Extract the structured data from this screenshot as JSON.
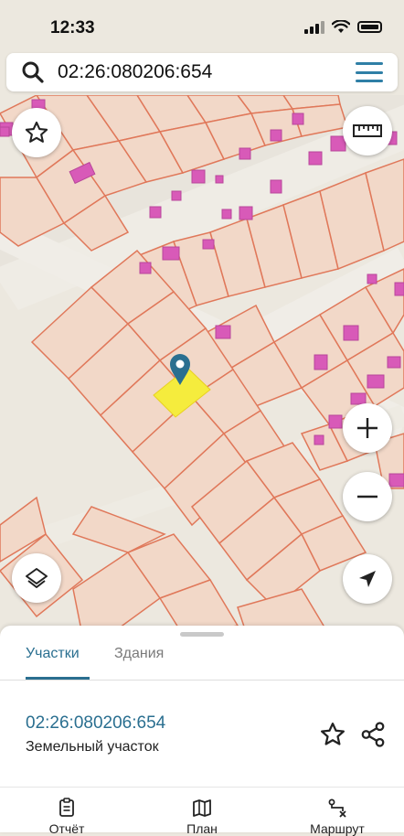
{
  "status": {
    "time": "12:33"
  },
  "search": {
    "query": "02:26:080206:654"
  },
  "map_buttons": {
    "favorite_icon": "star-outline",
    "ruler_icon": "ruler",
    "zoom_in_icon": "plus",
    "zoom_out_icon": "minus",
    "layers_icon": "layers",
    "location_icon": "navigation-arrow"
  },
  "colors": {
    "parcel_fill": "#f2d8c8",
    "parcel_stroke": "#e0785a",
    "building": "#d85ab8",
    "selected_parcel": "#f5ec3d",
    "pin": "#2a6f90",
    "accent": "#2a6f90"
  },
  "sheet": {
    "tabs": [
      "Участки",
      "Здания"
    ],
    "active_tab": "Участки",
    "parcel_number": "02:26:080206:654",
    "parcel_type": "Земельный участок"
  },
  "bottom_nav": {
    "items": [
      {
        "label": "Отчёт",
        "icon": "report-icon"
      },
      {
        "label": "План",
        "icon": "map-icon"
      },
      {
        "label": "Маршрут",
        "icon": "route-icon"
      }
    ]
  }
}
